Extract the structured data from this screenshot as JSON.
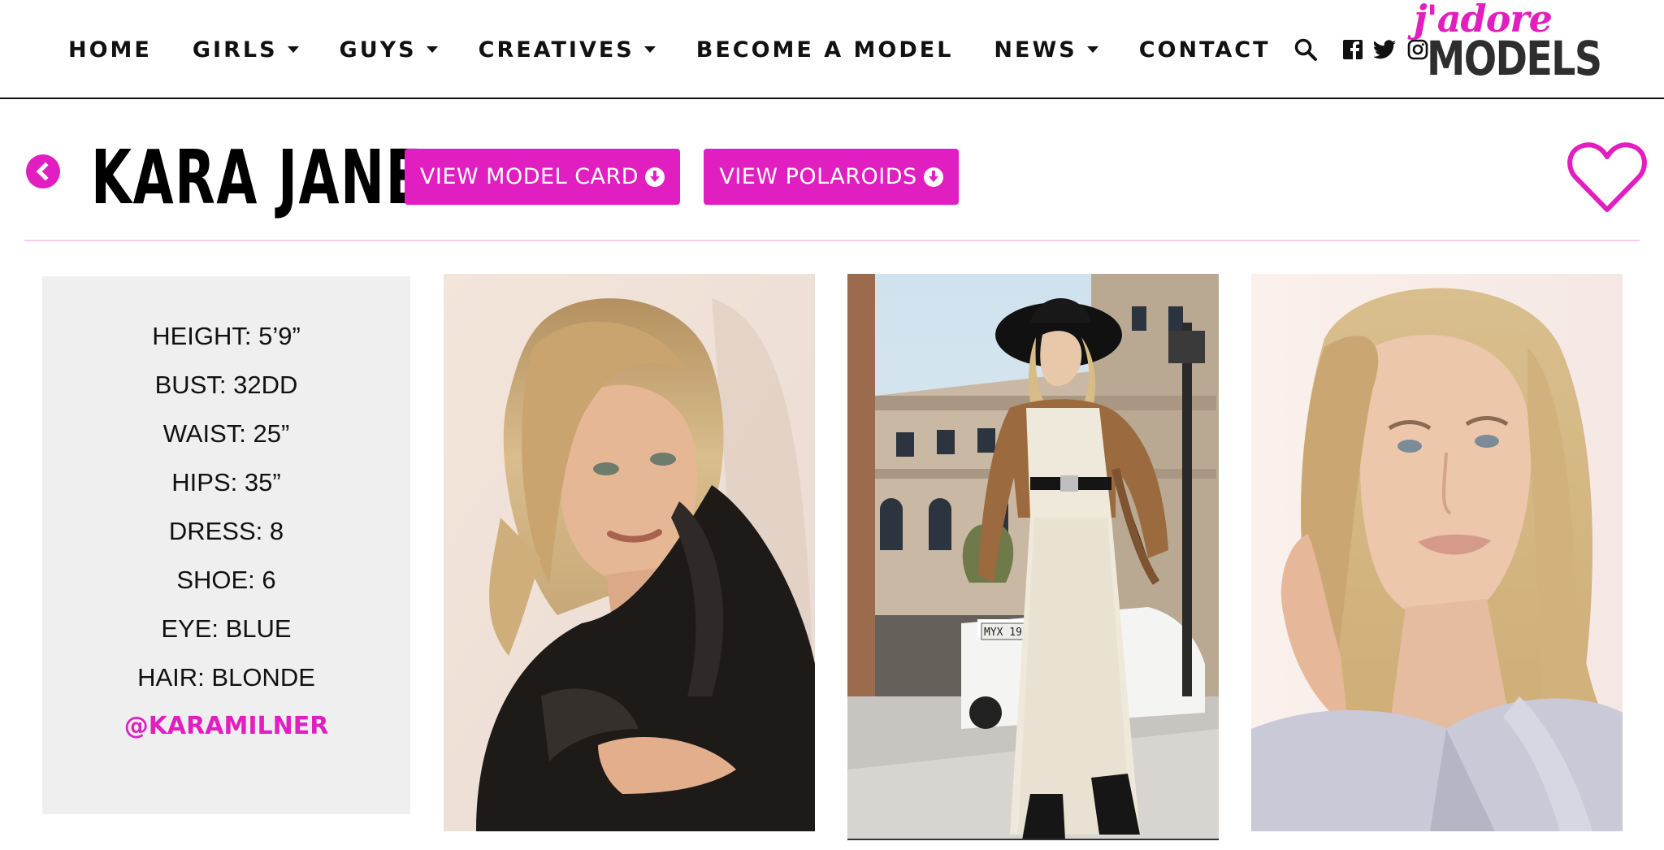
{
  "nav": {
    "items": [
      {
        "label": "HOME",
        "dropdown": false
      },
      {
        "label": "GIRLS",
        "dropdown": true
      },
      {
        "label": "GUYS",
        "dropdown": true
      },
      {
        "label": "CREATIVES",
        "dropdown": true
      },
      {
        "label": "BECOME A MODEL",
        "dropdown": false
      },
      {
        "label": "NEWS",
        "dropdown": true
      },
      {
        "label": "CONTACT",
        "dropdown": false
      }
    ],
    "icons": [
      "search-icon",
      "facebook-icon",
      "twitter-icon",
      "instagram-icon"
    ]
  },
  "logo": {
    "script": "j'adore",
    "word": "MODELS"
  },
  "profile": {
    "name": "KARA JANE",
    "model_card_label": "VIEW MODEL CARD",
    "polaroids_label": "VIEW POLAROIDS"
  },
  "stats": [
    "HEIGHT: 5’9”",
    "BUST: 32DD",
    "WAIST: 25”",
    "HIPS: 35”",
    "DRESS: 8",
    "SHOE: 6",
    "EYE: BLUE",
    "HAIR: BLONDE"
  ],
  "instagram_handle": "@KARAMILNER",
  "photos": [
    {
      "subject": "portrait-leather-jacket"
    },
    {
      "subject": "street-lace-dress-hat",
      "plate": "MYX 193X"
    },
    {
      "subject": "portrait-close-up"
    }
  ],
  "colors": {
    "accent": "#e11fc0",
    "panel": "#efefef",
    "divider": "#f6cdef"
  }
}
